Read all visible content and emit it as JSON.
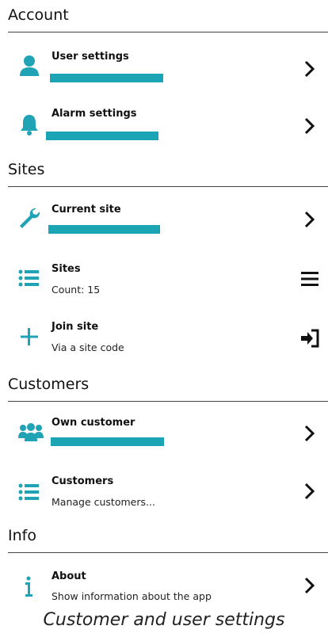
{
  "sections": {
    "account": "Account",
    "sites": "Sites",
    "customers": "Customers",
    "info": "Info"
  },
  "rows": {
    "user_settings": {
      "title": "User settings",
      "icon": "user-icon",
      "action_icon": "chevron-right-icon"
    },
    "alarm_settings": {
      "title": "Alarm settings",
      "icon": "bell-icon",
      "action_icon": "chevron-right-icon"
    },
    "current_site": {
      "title": "Current site",
      "icon": "wrench-icon",
      "action_icon": "chevron-right-icon"
    },
    "sites": {
      "title": "Sites",
      "subtitle": "Count: 15",
      "icon": "list-icon",
      "action_icon": "hamburger-menu-icon"
    },
    "join_site": {
      "title": "Join site",
      "subtitle": "Via a site code",
      "icon": "plus-icon",
      "action_icon": "sign-in-icon"
    },
    "own_customer": {
      "title": "Own customer",
      "icon": "users-icon",
      "action_icon": "chevron-right-icon"
    },
    "customers": {
      "title": "Customers",
      "subtitle": "Manage customers...",
      "icon": "list-icon",
      "action_icon": "chevron-right-icon"
    },
    "about": {
      "title": "About",
      "subtitle": "Show information about the app",
      "icon": "info-icon",
      "action_icon": "chevron-right-icon"
    }
  },
  "colors": {
    "accent": "#1fa3b5",
    "redaction": "#1ba5b4"
  },
  "caption": "Customer and user settings"
}
